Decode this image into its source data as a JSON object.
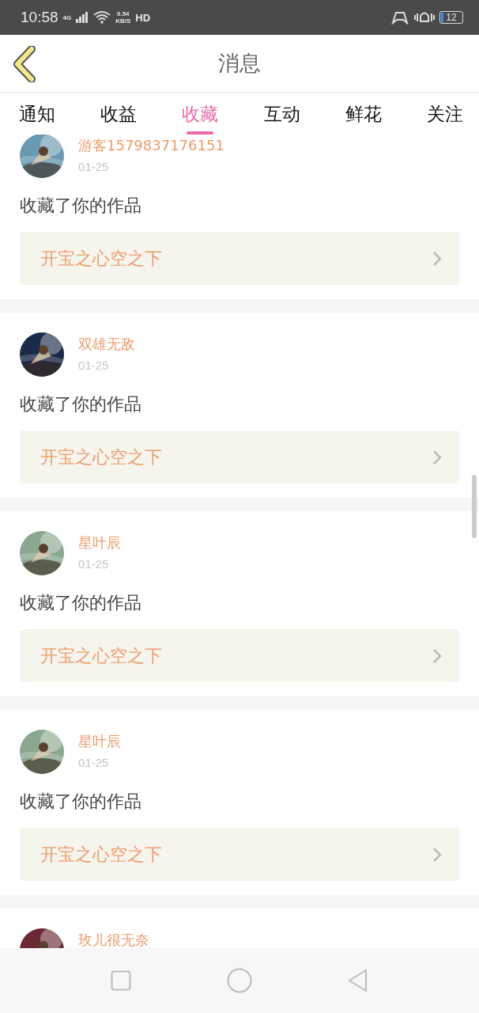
{
  "status_bar": {
    "time": "10:58",
    "network": "4G",
    "speed": "0.54",
    "speed_unit": "KB/S",
    "hd": "HD",
    "battery": "12"
  },
  "header": {
    "title": "消息"
  },
  "tabs": [
    {
      "label": "通知",
      "selected": false
    },
    {
      "label": "收益",
      "selected": false
    },
    {
      "label": "收藏",
      "selected": true
    },
    {
      "label": "互动",
      "selected": false
    },
    {
      "label": "鲜花",
      "selected": false
    },
    {
      "label": "关注",
      "selected": false
    }
  ],
  "messages": [
    {
      "user": "游客1579837176151",
      "date": "01-25",
      "text": "收藏了你的作品",
      "work": "开宝之心空之下"
    },
    {
      "user": "双雄无敌",
      "date": "01-25",
      "text": "收藏了你的作品",
      "work": "开宝之心空之下"
    },
    {
      "user": "星叶辰",
      "date": "01-25",
      "text": "收藏了你的作品",
      "work": "开宝之心空之下"
    },
    {
      "user": "星叶辰",
      "date": "01-25",
      "text": "收藏了你的作品",
      "work": "开宝之心空之下"
    },
    {
      "user": "玫儿很无奈"
    }
  ]
}
